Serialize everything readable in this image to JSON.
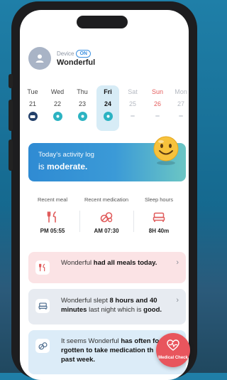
{
  "header": {
    "device_label": "Device",
    "device_status": "ON",
    "user_name": "Wonderful"
  },
  "week": [
    {
      "day": "Tue",
      "date": "21",
      "state": "dark"
    },
    {
      "day": "Wed",
      "date": "22",
      "state": "done"
    },
    {
      "day": "Thu",
      "date": "23",
      "state": "done"
    },
    {
      "day": "Fri",
      "date": "24",
      "state": "today"
    },
    {
      "day": "Sat",
      "date": "25",
      "state": "future"
    },
    {
      "day": "Sun",
      "date": "26",
      "state": "sunday"
    },
    {
      "day": "Mon",
      "date": "27",
      "state": "future"
    }
  ],
  "activity": {
    "line1": "Today's activity log",
    "line2_prefix": "is",
    "line2_value": "moderate."
  },
  "stats": [
    {
      "label": "Recent meal",
      "icon": "fork-knife-icon",
      "value": "PM 05:55"
    },
    {
      "label": "Recent medication",
      "icon": "pills-icon",
      "value": "AM 07:30"
    },
    {
      "label": "Sleep hours",
      "icon": "bed-icon",
      "value": "8H 40m"
    }
  ],
  "cards": {
    "meal": {
      "pre": "Wonderful ",
      "bold": "had all meals today."
    },
    "sleep": {
      "pre": "Wonderful slept ",
      "bold1": "8 hours and 40 minutes",
      "mid": " last night which is ",
      "bold2": "good."
    },
    "medication": {
      "pre": "It seems Wonderful ",
      "bold": "has often fo rgotten to take medication th past week."
    }
  },
  "fab": {
    "label": "Medical Check"
  },
  "colors": {
    "accent": "#2f8bd3",
    "meal_icon": "#e05b5b",
    "fab": "#e8555d",
    "teal": "#2cb3c2"
  }
}
